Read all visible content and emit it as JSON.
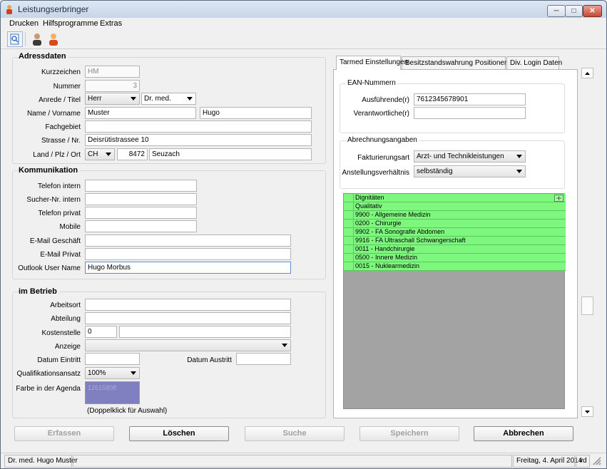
{
  "window": {
    "title": "Leistungserbringer",
    "min": "─",
    "max": "□",
    "close": "✕"
  },
  "menu": [
    "Drucken",
    "Hilfsprogramme",
    "Extras"
  ],
  "toolbar": {
    "icons": [
      "search-document-icon",
      "user-dark-icon",
      "user-orange-icon"
    ]
  },
  "adressdaten": {
    "title": "Adressdaten",
    "kurzzeichen_label": "Kurzzeichen",
    "kurzzeichen": "HM",
    "nummer_label": "Nummer",
    "nummer": "3",
    "anrede_label": "Anrede / Titel",
    "anrede": "Herr",
    "titel": "Dr. med.",
    "name_label": "Name / Vorname",
    "name": "Muster",
    "vorname": "Hugo",
    "fachgebiet_label": "Fachgebiet",
    "fachgebiet": "",
    "strasse_label": "Strasse / Nr.",
    "strasse": "Deisrütistrassee 10",
    "ort_label": "Land / Plz / Ort",
    "land": "CH",
    "plz": "8472",
    "ort": "Seuzach"
  },
  "kommunikation": {
    "title": "Kommunikation",
    "telefon_intern_label": "Telefon intern",
    "telefon_intern": "",
    "sucher_label": "Sucher-Nr. intern",
    "sucher": "",
    "telefon_privat_label": "Telefon privat",
    "telefon_privat": "",
    "mobile_label": "Mobile",
    "mobile": "",
    "email_geschaeft_label": "E-Mail Geschäft",
    "email_geschaeft": "",
    "email_privat_label": "E-Mail Privat",
    "email_privat": "",
    "outlook_label": "Outlook User Name",
    "outlook": "Hugo Morbus"
  },
  "betrieb": {
    "title": "im Betrieb",
    "arbeitsort_label": "Arbeitsort",
    "arbeitsort": "",
    "abteilung_label": "Abteilung",
    "abteilung": "",
    "kostenstelle_label": "Kostenstelle",
    "kostenstelle": "0",
    "kostenstelle2": "",
    "anzeige_label": "Anzeige",
    "anzeige": "",
    "eintritt_label": "Datum Eintritt",
    "eintritt": "",
    "austritt_label": "Datum Austritt",
    "austritt": "",
    "qualifikation_label": "Qualifikationsansatz",
    "qualifikation": "100%",
    "farbe_label": "Farbe in der Agenda",
    "farbe_value": "12615808",
    "farbe_color": "#8080c0",
    "farbe_hint": "(Doppelklick für Auswahl)"
  },
  "tabs": [
    "Tarmed Einstellungen",
    "Besitzstandswahrung Positionenliste",
    "Div. Login Daten"
  ],
  "ean": {
    "title": "EAN-Nummern",
    "ausfuehrende_label": "Ausführende(r)",
    "ausfuehrende": "7612345678901",
    "verantwortliche_label": "Verantwortliche(r)",
    "verantwortliche": ""
  },
  "abrechnung": {
    "title": "Abrechnungsangaben",
    "fakturierung_label": "Fakturierungsart",
    "fakturierung": "Arzt- und Technikleistungen",
    "anstellung_label": "Anstellungsverhältnis",
    "anstellung": "selbständig"
  },
  "dignitaeten": {
    "header": "Dignitäten",
    "sub": "Qualitativ",
    "rows": [
      "9900 - Allgemeine Medizin",
      "0200 - Chirurgie",
      "9902 - FA Sonografie Abdomen",
      "9916 - FA Ultraschall Schwangerschaft",
      "0011 - Handchirurgie",
      "0500 - Innere Medizin",
      "0015 - Nuklearmedizin"
    ]
  },
  "buttons": {
    "erfassen": "Erfassen",
    "loeschen": "Löschen",
    "suche": "Suche",
    "speichern": "Speichern",
    "abbrechen": "Abbrechen"
  },
  "status": {
    "user": "Dr. med. Hugo Muster",
    "date": "Freitag, 4. April 2014",
    "code": "vd"
  },
  "colors": {
    "grid_row": "#7ef77e",
    "grid_bg": "#a3a3a3"
  }
}
